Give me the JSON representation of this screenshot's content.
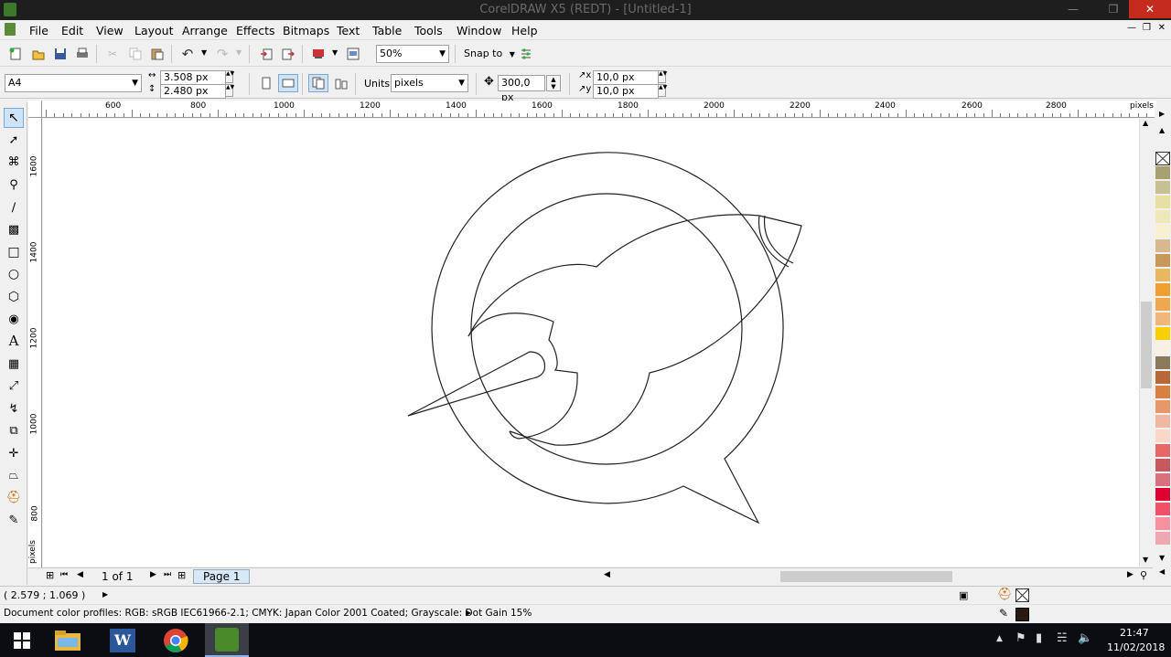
{
  "window": {
    "title": "CorelDRAW X5 (REDT) - [Untitled-1]",
    "controls": [
      "minimize",
      "restore",
      "close"
    ]
  },
  "menubar": {
    "items": [
      {
        "label": "File",
        "mnemonic": "F"
      },
      {
        "label": "Edit",
        "mnemonic": "E"
      },
      {
        "label": "View",
        "mnemonic": "V"
      },
      {
        "label": "Layout",
        "mnemonic": "L"
      },
      {
        "label": "Arrange",
        "mnemonic": "A"
      },
      {
        "label": "Effects",
        "mnemonic": "c"
      },
      {
        "label": "Bitmaps",
        "mnemonic": "B"
      },
      {
        "label": "Text",
        "mnemonic": "x"
      },
      {
        "label": "Table",
        "mnemonic": "T"
      },
      {
        "label": "Tools",
        "mnemonic": "o"
      },
      {
        "label": "Window",
        "mnemonic": "W"
      },
      {
        "label": "Help",
        "mnemonic": "H"
      }
    ]
  },
  "standard_toolbar": {
    "zoom_value": "50%",
    "snap_label": "Snap to"
  },
  "property_bar": {
    "paper_size": "A4",
    "width": "3.508 px",
    "height": "2.480 px",
    "units_label": "Units:",
    "units_value": "pixels",
    "nudge": "300,0 px",
    "dup_x": "10,0 px",
    "dup_y": "10,0 px"
  },
  "rulers": {
    "unit": "pixels",
    "h_labels": [
      "600",
      "800",
      "1000",
      "1200",
      "1400",
      "1600",
      "1800",
      "2000",
      "2200",
      "2400",
      "2600",
      "2800"
    ],
    "v_labels": [
      "1600",
      "1400",
      "1200",
      "1000",
      "800"
    ]
  },
  "page_nav": {
    "counter": "1 of 1",
    "page_tab": "Page 1"
  },
  "status": {
    "coords": "( 2.579 ; 1.069 )",
    "color_profiles": "Document color profiles: RGB: sRGB IEC61966-2.1; CMYK: Japan Color 2001 Coated; Grayscale: Dot Gain 15%"
  },
  "palette": {
    "colors": [
      "#a8a070",
      "#c8c090",
      "#e8e0a0",
      "#f0e8b8",
      "#f8f0d0",
      "#d8b890",
      "#c89858",
      "#e8b860",
      "#f0a030",
      "#f0a850",
      "#f0b878",
      "#f8d000",
      "#f8f0e0",
      "#8a7a5a",
      "#b86838",
      "#d88040",
      "#e89868",
      "#f0b8a0",
      "#f8d8c8",
      "#e86868",
      "#c85860",
      "#d87080",
      "#e00030",
      "#f05068",
      "#f890a0",
      "#f0a8b0"
    ]
  },
  "taskbar": {
    "time": "21:47",
    "date": "11/02/2018"
  }
}
